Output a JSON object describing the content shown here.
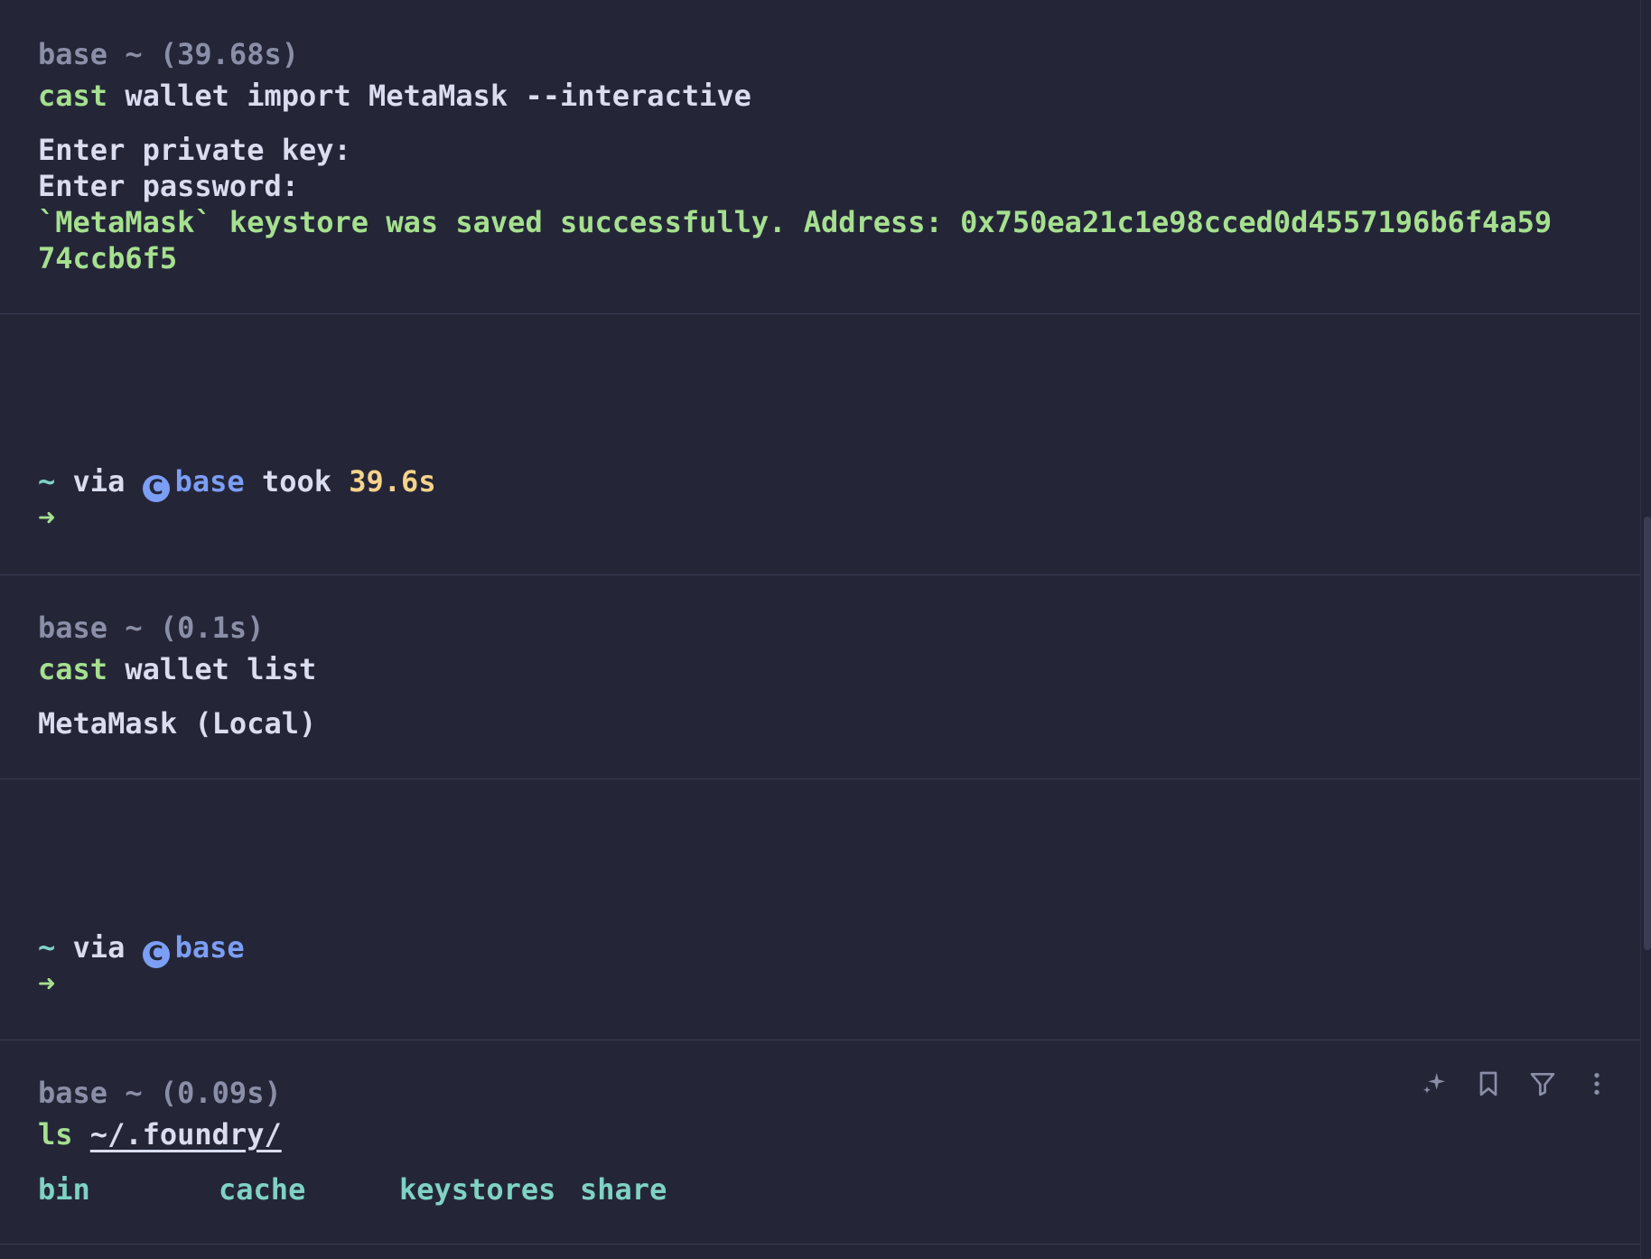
{
  "blocks": [
    {
      "header": "base ~ (39.68s)",
      "command": {
        "name": "cast",
        "args": " wallet import MetaMask --interactive"
      },
      "output": [
        "Enter private key:",
        "Enter password:",
        "`MetaMask` keystore was saved successfully. Address: 0x750ea21c1e98cced0d4557196b6f4a59",
        "74ccb6f5"
      ]
    },
    {
      "prompt": {
        "dir": "~",
        "via": " via ",
        "icon": "C",
        "env": "base",
        "took": " took ",
        "duration": "39.6s"
      },
      "arrow": "➜"
    },
    {
      "header": "base ~ (0.1s)",
      "command": {
        "name": "cast",
        "args": " wallet list"
      },
      "output": [
        "MetaMask (Local)"
      ]
    },
    {
      "prompt": {
        "dir": "~",
        "via": " via ",
        "icon": "C",
        "env": "base"
      },
      "arrow": "➜"
    },
    {
      "header": "base ~ (0.09s)",
      "command": {
        "name": "ls",
        "space": " ",
        "path": "~/.foundry/"
      },
      "listing": [
        "bin",
        "cache",
        "keystores",
        "share"
      ],
      "actions": [
        "ai-sparkle-icon",
        "bookmark-icon",
        "filter-icon",
        "more-vertical-icon"
      ]
    }
  ],
  "colors": {
    "background": "#242638",
    "command": "#a6e08f",
    "muted": "#8a8ea6",
    "env": "#7c9ef5",
    "duration": "#f5d38a",
    "listing": "#7fd2c4"
  }
}
